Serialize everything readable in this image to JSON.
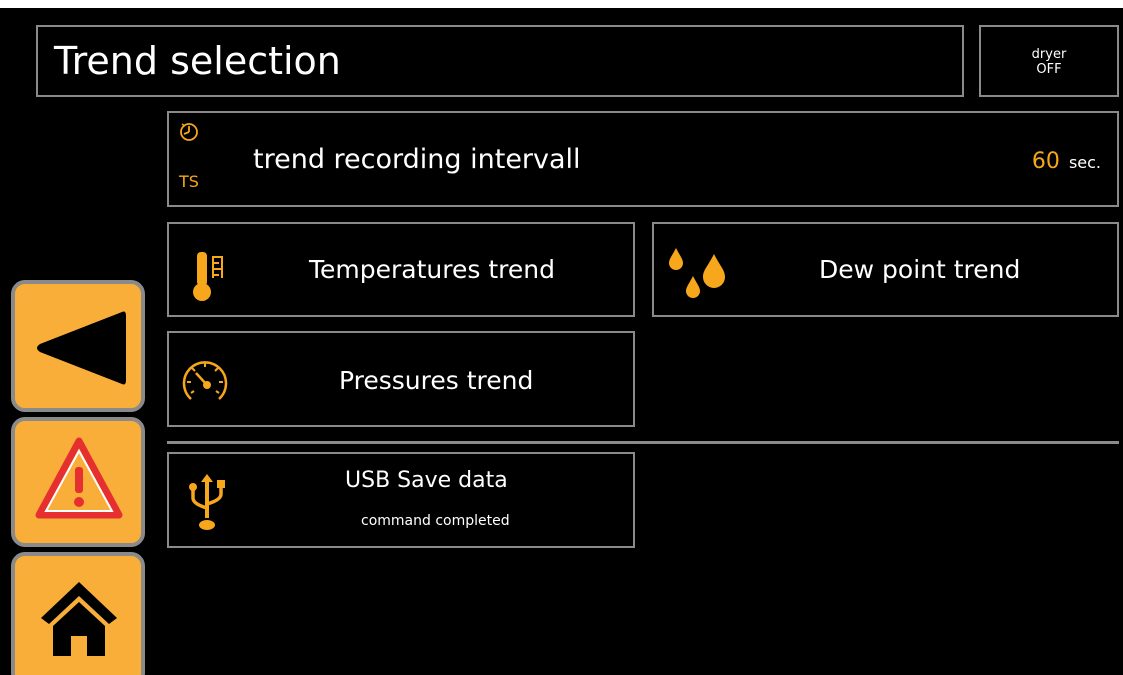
{
  "header": {
    "title": "Trend selection",
    "dryer_label": "dryer",
    "dryer_state": "OFF"
  },
  "interval": {
    "icon_label": "TS",
    "label": "trend recording intervall",
    "value": "60",
    "unit": "sec."
  },
  "menu": {
    "temperatures": "Temperatures trend",
    "dew_point": "Dew point trend",
    "pressures": "Pressures trend",
    "usb_title": "USB Save data",
    "usb_status": "command completed"
  },
  "nav": {
    "icons": [
      "back-arrow-icon",
      "warning-icon",
      "home-icon"
    ]
  },
  "colors": {
    "background": "#000000",
    "border": "#8a8a8a",
    "accent": "#f7a71b",
    "nav_button": "#f9ae3a",
    "warning_red": "#e63030"
  }
}
